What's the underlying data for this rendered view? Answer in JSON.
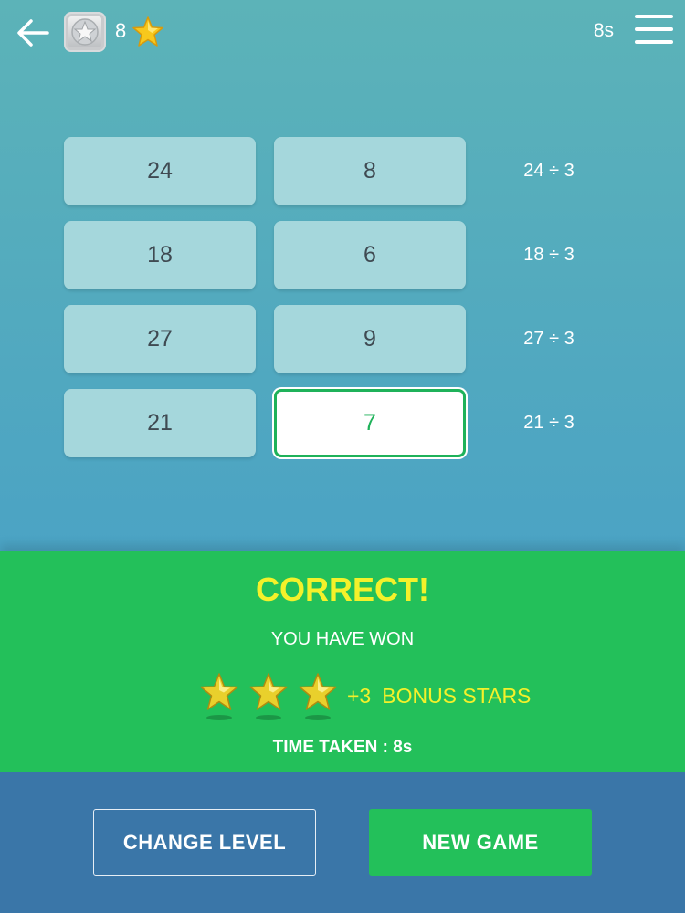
{
  "header": {
    "star_count": "8",
    "timer": "8s",
    "icons": {
      "back": "back-arrow-icon",
      "badge": "silver-star-badge-icon",
      "star": "gold-star-icon",
      "menu": "hamburger-menu-icon"
    }
  },
  "grid": {
    "left": [
      "24",
      "18",
      "27",
      "21"
    ],
    "right": [
      "8",
      "6",
      "9",
      "7"
    ],
    "hints": [
      "24 ÷ 3",
      "18 ÷ 3",
      "27 ÷ 3",
      "21 ÷ 3"
    ],
    "selected_index": 3
  },
  "result": {
    "title": "CORRECT!",
    "subtitle": "YOU HAVE WON",
    "bonus_count": 3,
    "bonus_plus": "+3",
    "bonus_label": "BONUS STARS",
    "time_taken": "TIME TAKEN : 8s"
  },
  "actions": {
    "change_level": "CHANGE LEVEL",
    "new_game": "NEW GAME"
  },
  "colors": {
    "accent_green": "#23c05a",
    "title_yellow": "#f4f12a",
    "bottom_blue": "#3a76a8"
  }
}
